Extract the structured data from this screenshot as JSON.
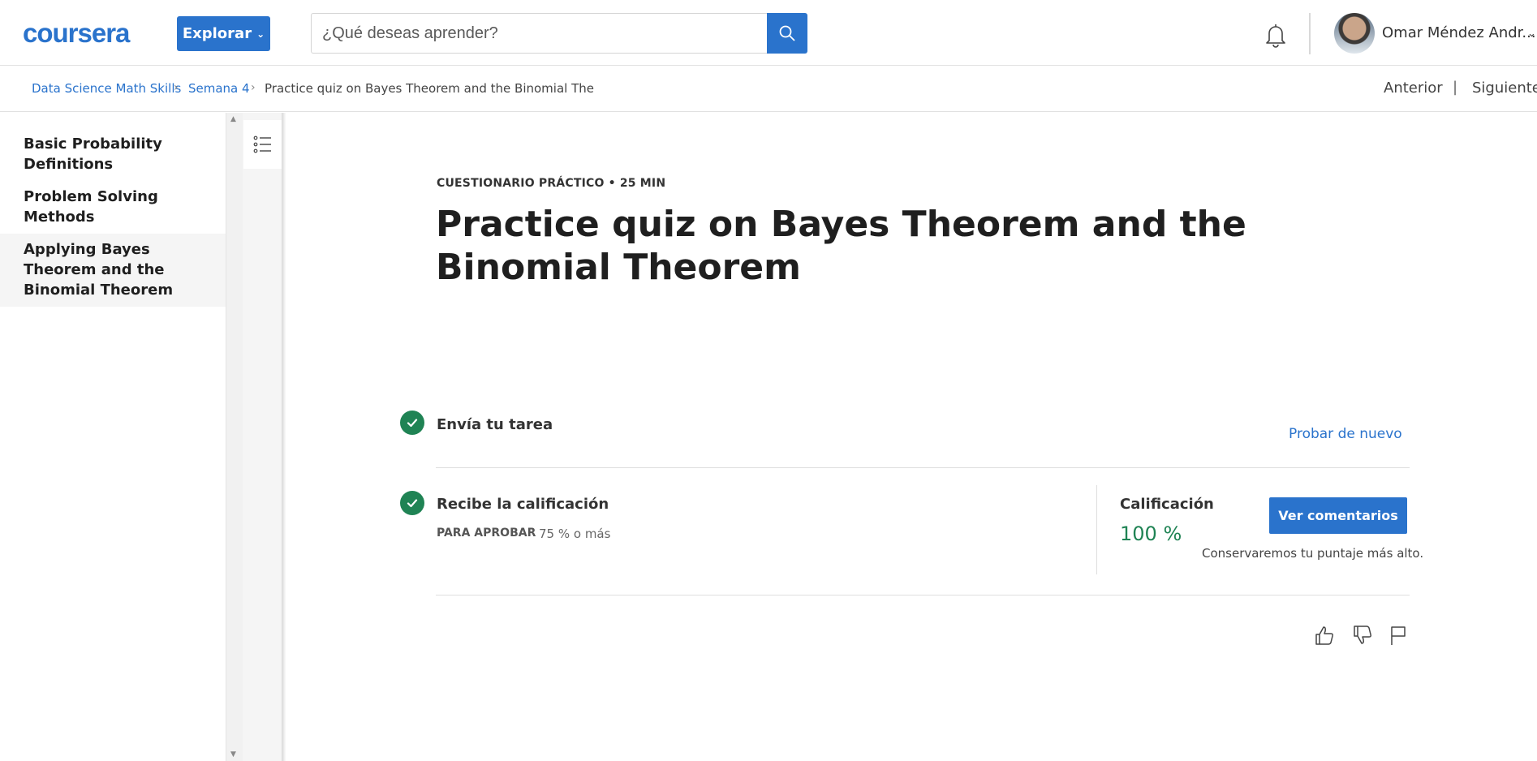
{
  "header": {
    "logo_text": "coursera",
    "explore_label": "Explorar",
    "search_placeholder": "¿Qué deseas aprender?",
    "user_name": "Omar Méndez Andr..."
  },
  "breadcrumb": {
    "items": [
      "Data Science Math Skills",
      "Semana 4",
      "Practice quiz on Bayes Theorem and the Binomial The"
    ],
    "separator": "›",
    "prev_label": "Anterior",
    "divider": "|",
    "next_label": "Siguiente"
  },
  "sidebar": {
    "items": [
      {
        "label": "Basic Probability Definitions",
        "active": false
      },
      {
        "label": "Problem Solving Methods",
        "active": false
      },
      {
        "label": "Applying Bayes Theorem and the Binomial Theorem",
        "active": true
      }
    ]
  },
  "main": {
    "eyebrow": "CUESTIONARIO PRÁCTICO • 25 MIN",
    "title": "Practice quiz on Bayes Theorem and the Binomial Theorem",
    "step1_label": "Envía tu tarea",
    "retry_label": "Probar de nuevo",
    "step2_label": "Recibe la calificación",
    "pass_label": "PARA APROBAR",
    "pass_value": "75 % o más",
    "grade_label": "Calificación",
    "grade_value": "100 %",
    "comments_button": "Ver comentarios",
    "keep_note": "Conservaremos tu puntaje más alto."
  },
  "colors": {
    "brand_blue": "#2a73cc",
    "success_green": "#1f8354"
  },
  "icons": [
    "search-icon",
    "bell-icon",
    "list-icon",
    "check-icon",
    "thumbs-up-icon",
    "thumbs-down-icon",
    "flag-icon"
  ]
}
